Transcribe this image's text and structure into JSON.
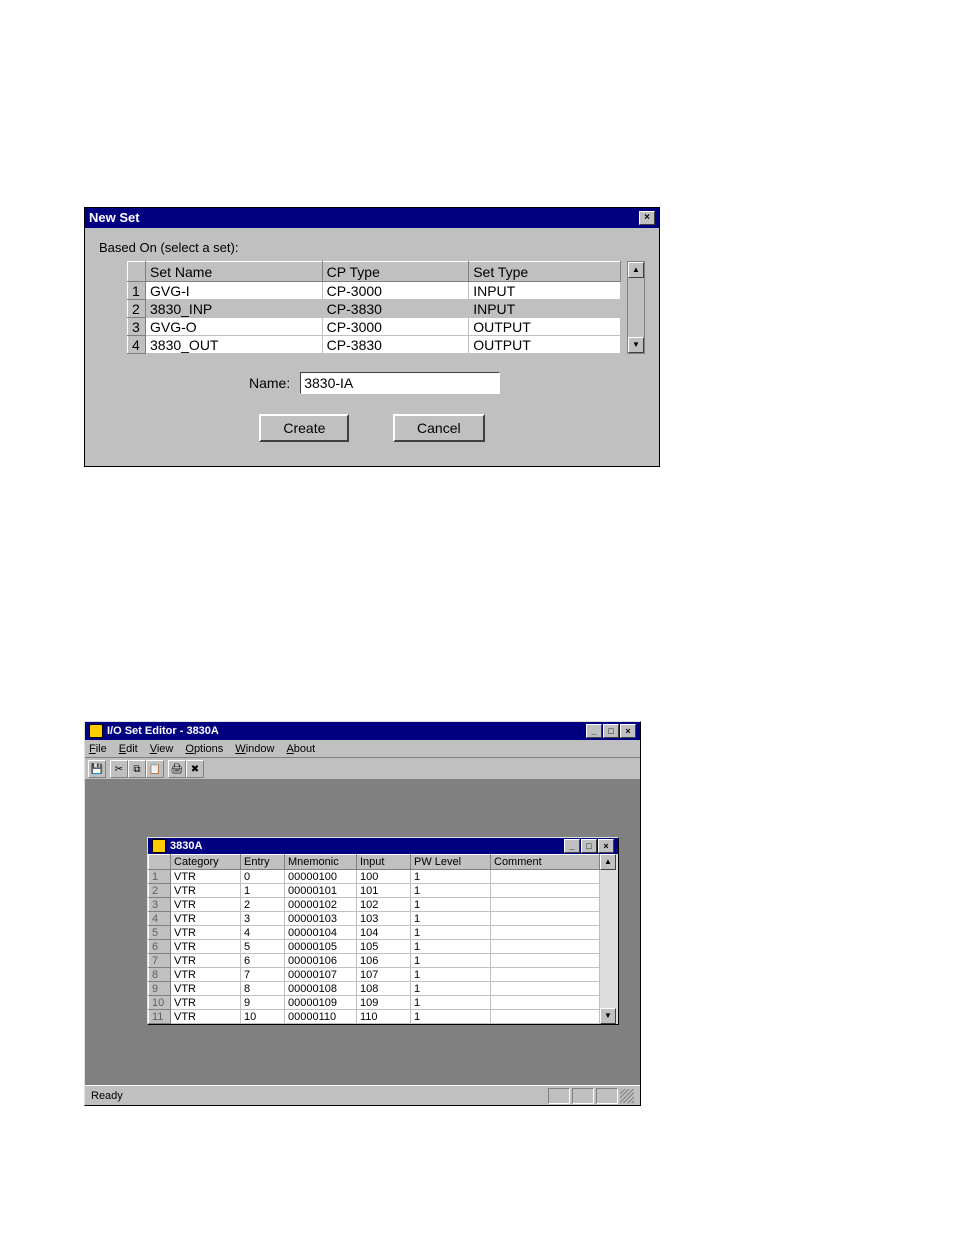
{
  "dialog1": {
    "title": "New Set",
    "based_on_label": "Based On (select a set):",
    "columns": {
      "set_name": "Set Name",
      "cp_type": "CP Type",
      "set_type": "Set Type"
    },
    "rows": [
      {
        "n": "1",
        "set_name": "GVG-I",
        "cp_type": "CP-3000",
        "set_type": "INPUT",
        "selected": false
      },
      {
        "n": "2",
        "set_name": "3830_INP",
        "cp_type": "CP-3830",
        "set_type": "INPUT",
        "selected": true
      },
      {
        "n": "3",
        "set_name": "GVG-O",
        "cp_type": "CP-3000",
        "set_type": "OUTPUT",
        "selected": false
      },
      {
        "n": "4",
        "set_name": "3830_OUT",
        "cp_type": "CP-3830",
        "set_type": "OUTPUT",
        "selected": false
      }
    ],
    "name_label": "Name:",
    "name_value": "3830-IA",
    "create_label": "Create",
    "cancel_label": "Cancel"
  },
  "window2": {
    "title": "I/O Set Editor - 3830A",
    "menus": {
      "file": "File",
      "edit": "Edit",
      "view": "View",
      "options": "Options",
      "window": "Window",
      "about": "About"
    },
    "status": "Ready",
    "child": {
      "title": "3830A",
      "columns": {
        "category": "Category",
        "entry": "Entry",
        "mnemonic": "Mnemonic",
        "input": "Input",
        "pwlevel": "PW Level",
        "comment": "Comment"
      },
      "rows": [
        {
          "n": "1",
          "category": "VTR",
          "entry": "0",
          "mnemonic": "00000100",
          "input": "100",
          "pwlevel": "1",
          "comment": ""
        },
        {
          "n": "2",
          "category": "VTR",
          "entry": "1",
          "mnemonic": "00000101",
          "input": "101",
          "pwlevel": "1",
          "comment": ""
        },
        {
          "n": "3",
          "category": "VTR",
          "entry": "2",
          "mnemonic": "00000102",
          "input": "102",
          "pwlevel": "1",
          "comment": ""
        },
        {
          "n": "4",
          "category": "VTR",
          "entry": "3",
          "mnemonic": "00000103",
          "input": "103",
          "pwlevel": "1",
          "comment": ""
        },
        {
          "n": "5",
          "category": "VTR",
          "entry": "4",
          "mnemonic": "00000104",
          "input": "104",
          "pwlevel": "1",
          "comment": ""
        },
        {
          "n": "6",
          "category": "VTR",
          "entry": "5",
          "mnemonic": "00000105",
          "input": "105",
          "pwlevel": "1",
          "comment": ""
        },
        {
          "n": "7",
          "category": "VTR",
          "entry": "6",
          "mnemonic": "00000106",
          "input": "106",
          "pwlevel": "1",
          "comment": ""
        },
        {
          "n": "8",
          "category": "VTR",
          "entry": "7",
          "mnemonic": "00000107",
          "input": "107",
          "pwlevel": "1",
          "comment": ""
        },
        {
          "n": "9",
          "category": "VTR",
          "entry": "8",
          "mnemonic": "00000108",
          "input": "108",
          "pwlevel": "1",
          "comment": ""
        },
        {
          "n": "10",
          "category": "VTR",
          "entry": "9",
          "mnemonic": "00000109",
          "input": "109",
          "pwlevel": "1",
          "comment": ""
        },
        {
          "n": "11",
          "category": "VTR",
          "entry": "10",
          "mnemonic": "00000110",
          "input": "110",
          "pwlevel": "1",
          "comment": ""
        }
      ]
    }
  }
}
